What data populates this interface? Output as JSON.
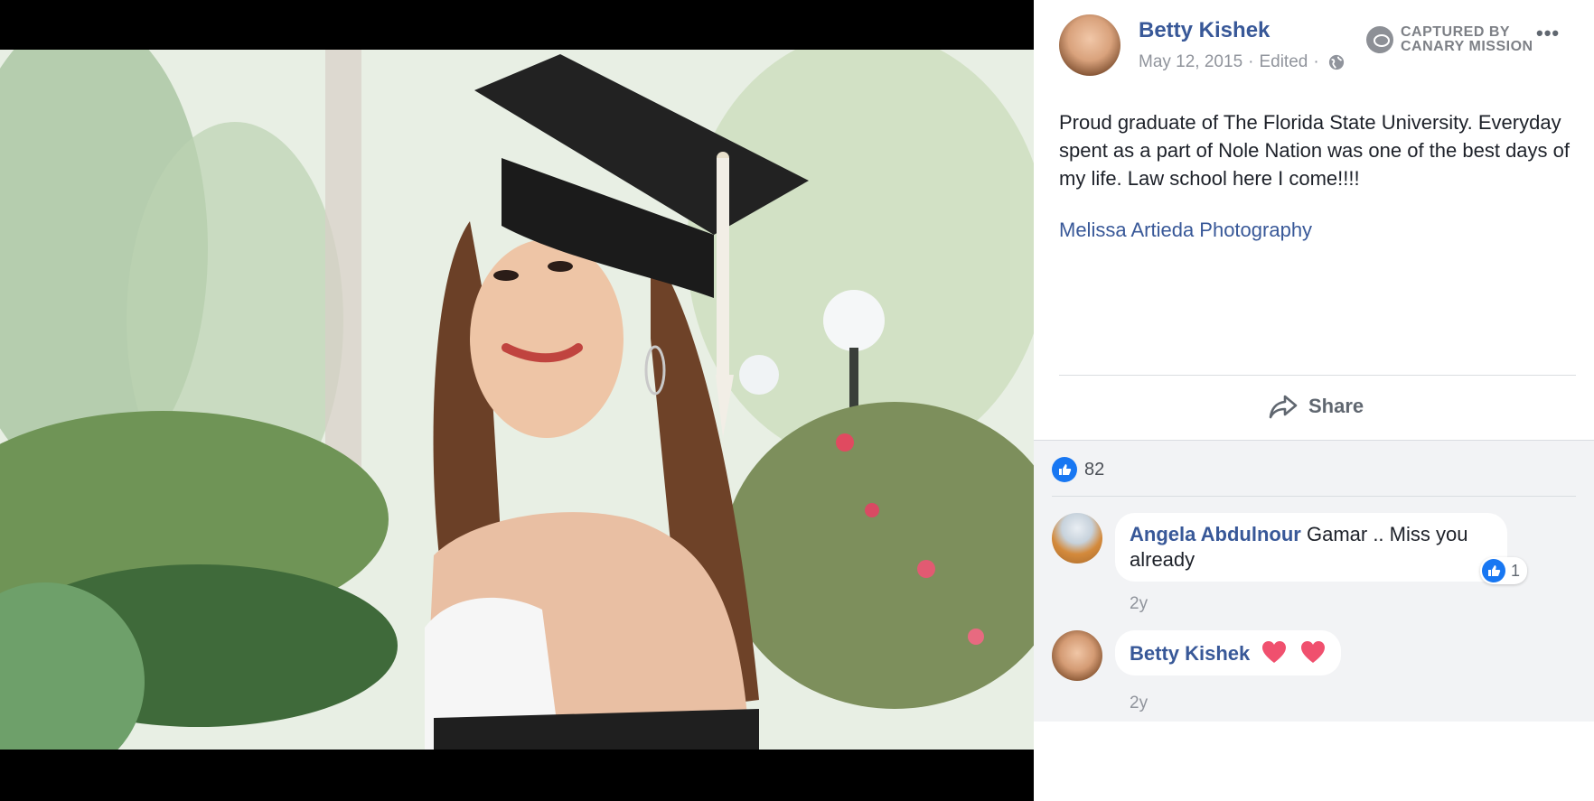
{
  "post": {
    "author": "Betty Kishek",
    "date": "May 12, 2015",
    "edited": "Edited",
    "separator": "·",
    "body": "Proud graduate of The Florida State University. Everyday spent as a part of Nole Nation was one of the best days of my life. Law school here I come!!!!",
    "link": "Melissa Artieda Photography",
    "privacy_icon": "globe-icon"
  },
  "watermark": {
    "line1": "CAPTURED BY",
    "line2": "CANARY MISSION"
  },
  "actions": {
    "share_label": "Share",
    "more_icon": "•••"
  },
  "reactions": {
    "like_count": "82",
    "icon": "like-icon"
  },
  "comments": [
    {
      "author": "Angela Abdulnour",
      "text": "Gamar .. Miss you already",
      "time": "2y",
      "likes": "1"
    },
    {
      "author": "Betty Kishek",
      "text": "",
      "emoji": "heart-icon heart-icon",
      "time": "2y"
    }
  ],
  "colors": {
    "link": "#385898",
    "like_blue": "#1877f2",
    "heart": "#f0506e",
    "muted": "#90949c"
  }
}
